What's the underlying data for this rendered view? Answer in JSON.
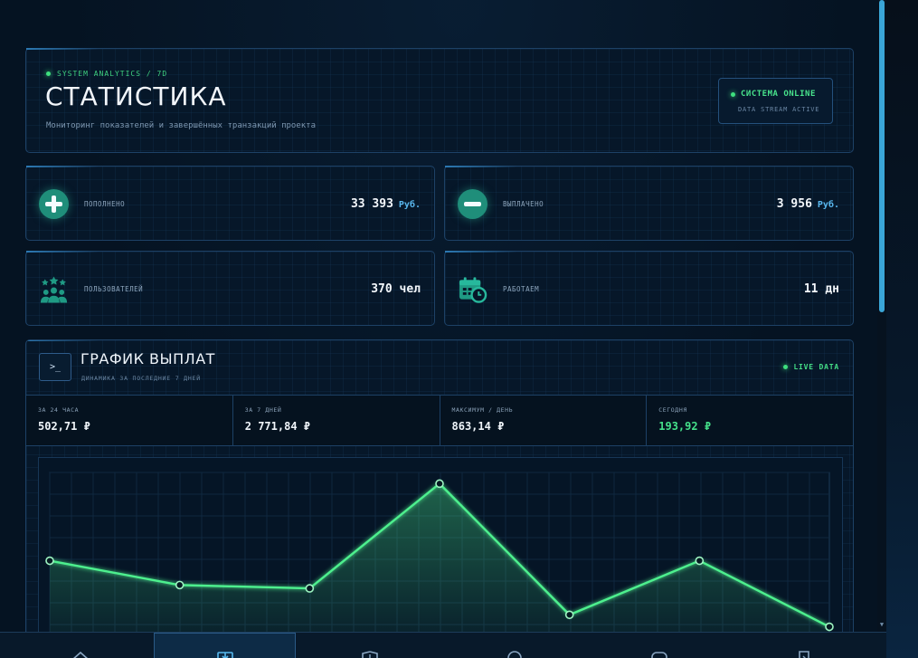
{
  "header": {
    "eyebrow": "SYSTEM ANALYTICS / 7D",
    "title": "СТАТИСТИКА",
    "subtitle": "Мониторинг показателей и завершённых транзакций проекта",
    "status": {
      "title": "СИСТЕМА ONLINE",
      "subtitle": "DATA STREAM ACTIVE"
    }
  },
  "stats": {
    "topup": {
      "label": "ПОПОЛНЕНО",
      "value": "33 393",
      "unit": "Руб.",
      "icon": "plus-circle-icon"
    },
    "paid": {
      "label": "ВЫПЛАЧЕНО",
      "value": "3 956",
      "unit": "Руб.",
      "icon": "minus-circle-icon"
    },
    "users": {
      "label": "ПОЛЬЗОВАТЕЛЕЙ",
      "value": "370 чел",
      "icon": "users-star-icon"
    },
    "days": {
      "label": "РАБОТАЕМ",
      "value": "11 дн",
      "icon": "calendar-clock-icon"
    }
  },
  "payout_chart": {
    "icon": ">_",
    "title": "ГРАФИК ВЫПЛАТ",
    "subtitle": "ДИНАМИКА ЗА ПОСЛЕДНИЕ 7 ДНЕЙ",
    "live": "LIVE DATA",
    "metrics": [
      {
        "label": "ЗА 24 ЧАСА",
        "value": "502,71 ₽"
      },
      {
        "label": "ЗА 7 ДНЕЙ",
        "value": "2 771,84 ₽"
      },
      {
        "label": "МАКСИМУМ / ДЕНЬ",
        "value": "863,14 ₽"
      },
      {
        "label": "СЕГОДНЯ",
        "value": "193,92 ₽"
      }
    ]
  },
  "chart_data": {
    "type": "line",
    "x": [
      1,
      2,
      3,
      4,
      5,
      6,
      7
    ],
    "values": [
      502.71,
      389.2,
      373.5,
      863.14,
      250.0,
      502.71,
      193.92
    ],
    "color": "#4ef08e",
    "grid": true
  },
  "bottom_nav": [
    {
      "icon": "home-icon",
      "active": false
    },
    {
      "icon": "download-icon",
      "active": true
    },
    {
      "icon": "shield-icon",
      "active": false
    },
    {
      "icon": "headset-icon",
      "active": false
    },
    {
      "icon": "chat-icon",
      "active": false
    },
    {
      "icon": "logout-icon",
      "active": false
    }
  ],
  "colors": {
    "accent": "#44de86",
    "panel_border": "#1d4166",
    "unit": "#59b8ef"
  }
}
